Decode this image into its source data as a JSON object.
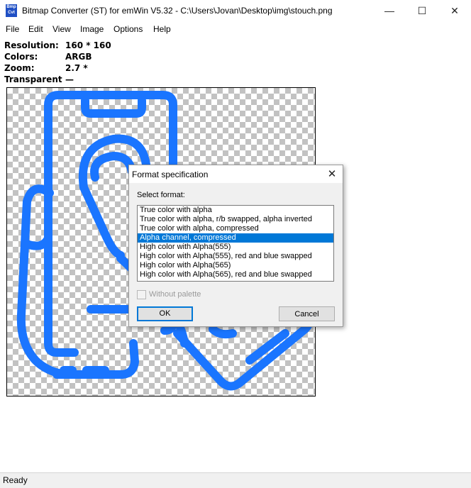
{
  "window": {
    "title": "Bitmap Converter (ST) for emWin V5.32 - C:\\Users\\Jovan\\Desktop\\img\\stouch.png",
    "icon_text": "Bmp Cvt",
    "minimize_icon": "minimize-icon",
    "maximize_icon": "maximize-icon",
    "close_icon": "close-icon"
  },
  "menu": [
    "File",
    "Edit",
    "View",
    "Image",
    "Options",
    "Help"
  ],
  "info": {
    "resolution_label": "Resolution:",
    "resolution_value": "160 * 160",
    "colors_label": "Colors:",
    "colors_value": "ARGB",
    "zoom_label": "Zoom:",
    "zoom_value": "2.7 *",
    "transparent_label": "Transparent",
    "transparent_value": "—"
  },
  "image": {
    "accent_color": "#1a75ff",
    "checker_color": "#c2c2c2"
  },
  "dialog": {
    "title": "Format specification",
    "select_label": "Select format:",
    "formats": [
      "True color with alpha",
      "True color with alpha, r/b swapped, alpha inverted",
      "True color with alpha, compressed",
      "Alpha channel, compressed",
      "High color with Alpha(555)",
      "High color with Alpha(555), red and blue swapped",
      "High color with Alpha(565)",
      "High color with Alpha(565), red and blue swapped"
    ],
    "selected_index": 3,
    "without_palette_label": "Without palette",
    "without_palette_checked": false,
    "ok_label": "OK",
    "cancel_label": "Cancel"
  },
  "status": {
    "text": "Ready"
  }
}
